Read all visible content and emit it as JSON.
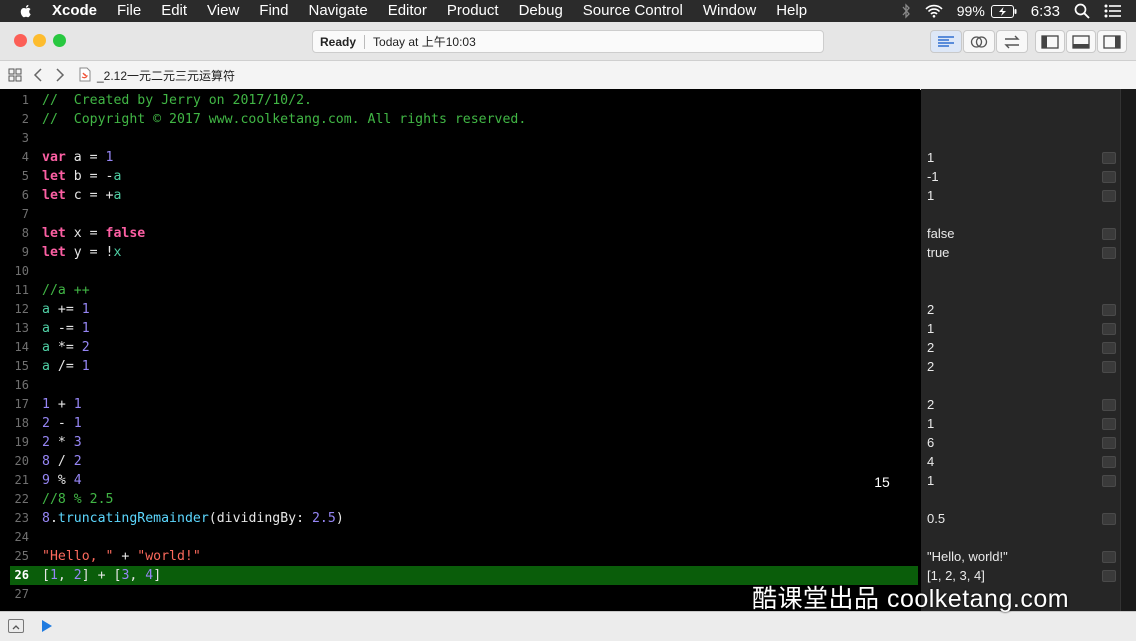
{
  "menubar": {
    "app_name": "Xcode",
    "items": [
      "File",
      "Edit",
      "View",
      "Find",
      "Navigate",
      "Editor",
      "Product",
      "Debug",
      "Source Control",
      "Window",
      "Help"
    ],
    "battery": "99%",
    "time": "6:33"
  },
  "toolbar": {
    "status": "Ready",
    "timestamp": "Today at 上午10:03"
  },
  "jumpbar": {
    "file_name": "_2.12一元二元三元运算符"
  },
  "editor": {
    "lines": [
      {
        "n": "1",
        "tokens": [
          {
            "t": "//  Created by Jerry on 2017/10/2.",
            "c": "comment"
          }
        ]
      },
      {
        "n": "2",
        "tokens": [
          {
            "t": "//  Copyright © 2017 www.coolketang.com. All rights reserved.",
            "c": "comment"
          }
        ]
      },
      {
        "n": "3",
        "tokens": []
      },
      {
        "n": "4",
        "tokens": [
          {
            "t": "var",
            "c": "kw"
          },
          {
            "t": " a = ",
            "c": "plain"
          },
          {
            "t": "1",
            "c": "num"
          }
        ]
      },
      {
        "n": "5",
        "tokens": [
          {
            "t": "let",
            "c": "kw"
          },
          {
            "t": " b = -",
            "c": "plain"
          },
          {
            "t": "a",
            "c": "var"
          }
        ]
      },
      {
        "n": "6",
        "tokens": [
          {
            "t": "let",
            "c": "kw"
          },
          {
            "t": " c = +",
            "c": "plain"
          },
          {
            "t": "a",
            "c": "var"
          }
        ]
      },
      {
        "n": "7",
        "tokens": []
      },
      {
        "n": "8",
        "tokens": [
          {
            "t": "let",
            "c": "kw"
          },
          {
            "t": " x = ",
            "c": "plain"
          },
          {
            "t": "false",
            "c": "kw"
          }
        ]
      },
      {
        "n": "9",
        "tokens": [
          {
            "t": "let",
            "c": "kw"
          },
          {
            "t": " y = !",
            "c": "plain"
          },
          {
            "t": "x",
            "c": "var"
          }
        ]
      },
      {
        "n": "10",
        "tokens": []
      },
      {
        "n": "11",
        "tokens": [
          {
            "t": "//a ++",
            "c": "comment"
          }
        ]
      },
      {
        "n": "12",
        "tokens": [
          {
            "t": "a",
            "c": "var"
          },
          {
            "t": " += ",
            "c": "plain"
          },
          {
            "t": "1",
            "c": "num"
          }
        ]
      },
      {
        "n": "13",
        "tokens": [
          {
            "t": "a",
            "c": "var"
          },
          {
            "t": " -= ",
            "c": "plain"
          },
          {
            "t": "1",
            "c": "num"
          }
        ]
      },
      {
        "n": "14",
        "tokens": [
          {
            "t": "a",
            "c": "var"
          },
          {
            "t": " *= ",
            "c": "plain"
          },
          {
            "t": "2",
            "c": "num"
          }
        ]
      },
      {
        "n": "15",
        "tokens": [
          {
            "t": "a",
            "c": "var"
          },
          {
            "t": " /= ",
            "c": "plain"
          },
          {
            "t": "1",
            "c": "num"
          }
        ]
      },
      {
        "n": "16",
        "tokens": []
      },
      {
        "n": "17",
        "tokens": [
          {
            "t": "1",
            "c": "num"
          },
          {
            "t": " + ",
            "c": "plain"
          },
          {
            "t": "1",
            "c": "num"
          }
        ]
      },
      {
        "n": "18",
        "tokens": [
          {
            "t": "2",
            "c": "num"
          },
          {
            "t": " - ",
            "c": "plain"
          },
          {
            "t": "1",
            "c": "num"
          }
        ]
      },
      {
        "n": "19",
        "tokens": [
          {
            "t": "2",
            "c": "num"
          },
          {
            "t": " * ",
            "c": "plain"
          },
          {
            "t": "3",
            "c": "num"
          }
        ]
      },
      {
        "n": "20",
        "tokens": [
          {
            "t": "8",
            "c": "num"
          },
          {
            "t": " / ",
            "c": "plain"
          },
          {
            "t": "2",
            "c": "num"
          }
        ]
      },
      {
        "n": "21",
        "tokens": [
          {
            "t": "9",
            "c": "num"
          },
          {
            "t": " % ",
            "c": "plain"
          },
          {
            "t": "4",
            "c": "num"
          }
        ]
      },
      {
        "n": "22",
        "tokens": [
          {
            "t": "//8 % 2.5",
            "c": "comment"
          }
        ]
      },
      {
        "n": "23",
        "tokens": [
          {
            "t": "8",
            "c": "num"
          },
          {
            "t": ".",
            "c": "plain"
          },
          {
            "t": "truncatingRemainder",
            "c": "fn"
          },
          {
            "t": "(dividingBy: ",
            "c": "plain"
          },
          {
            "t": "2.5",
            "c": "num"
          },
          {
            "t": ")",
            "c": "plain"
          }
        ]
      },
      {
        "n": "24",
        "tokens": []
      },
      {
        "n": "25",
        "tokens": [
          {
            "t": "\"Hello, \"",
            "c": "str"
          },
          {
            "t": " + ",
            "c": "plain"
          },
          {
            "t": "\"world!\"",
            "c": "str"
          }
        ]
      },
      {
        "n": "26",
        "tokens": [
          {
            "t": "[",
            "c": "plain"
          },
          {
            "t": "1",
            "c": "num"
          },
          {
            "t": ", ",
            "c": "plain"
          },
          {
            "t": "2",
            "c": "num"
          },
          {
            "t": "] + [",
            "c": "plain"
          },
          {
            "t": "3",
            "c": "num"
          },
          {
            "t": ", ",
            "c": "plain"
          },
          {
            "t": "4",
            "c": "num"
          },
          {
            "t": "]",
            "c": "plain"
          }
        ],
        "current": true
      },
      {
        "n": "27",
        "tokens": []
      }
    ],
    "overlay_badge": "15"
  },
  "results": [
    {
      "line": "4",
      "value": "1"
    },
    {
      "line": "5",
      "value": "-1"
    },
    {
      "line": "6",
      "value": "1"
    },
    {
      "line": "8",
      "value": "false"
    },
    {
      "line": "9",
      "value": "true"
    },
    {
      "line": "12",
      "value": "2"
    },
    {
      "line": "13",
      "value": "1"
    },
    {
      "line": "14",
      "value": "2"
    },
    {
      "line": "15",
      "value": "2"
    },
    {
      "line": "17",
      "value": "2"
    },
    {
      "line": "18",
      "value": "1"
    },
    {
      "line": "19",
      "value": "6"
    },
    {
      "line": "20",
      "value": "4"
    },
    {
      "line": "21",
      "value": "1"
    },
    {
      "line": "23",
      "value": "0.5"
    },
    {
      "line": "25",
      "value": "\"Hello, world!\""
    },
    {
      "line": "26",
      "value": "[1, 2, 3, 4]"
    }
  ],
  "watermark": "酷课堂出品 coolketang.com"
}
